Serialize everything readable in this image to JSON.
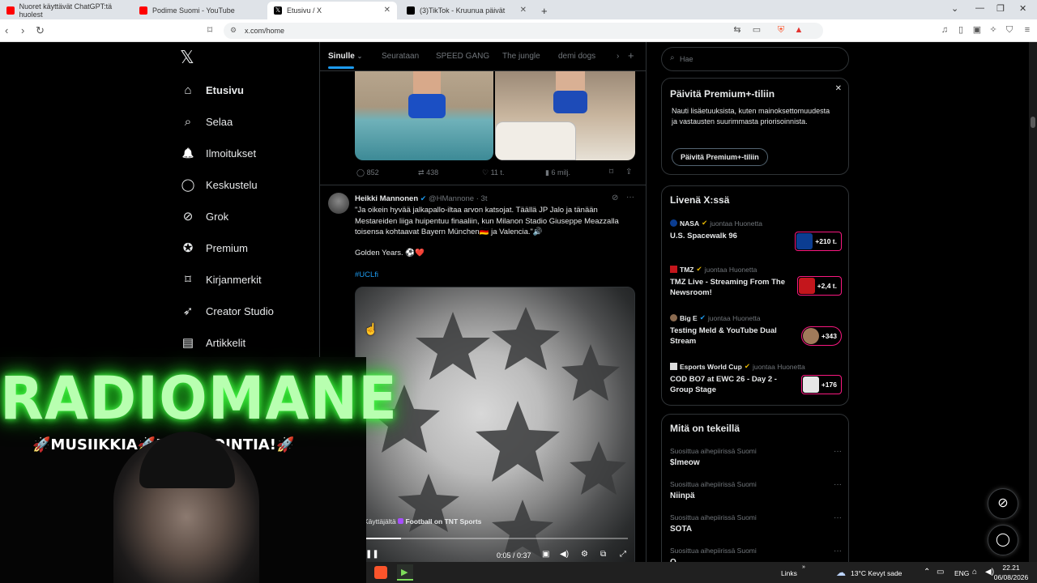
{
  "browser": {
    "tabs": [
      {
        "title": "Nuoret käyttävät ChatGPT:tä huolest",
        "color": "#ff0000"
      },
      {
        "title": "Podime Suomi - YouTube",
        "color": "#ff0000"
      },
      {
        "title": "Etusivu / X",
        "color": "#000000"
      },
      {
        "title": "(3)TikTok - Kruunua päivät",
        "color": "#000000"
      }
    ],
    "new_tab": "+",
    "url": "x.com/home"
  },
  "nav": {
    "logo": "𝕏",
    "items": [
      {
        "label": "Etusivu",
        "icon": "home-icon",
        "glyph": "⌂"
      },
      {
        "label": "Selaa",
        "icon": "search-icon",
        "glyph": "⌕"
      },
      {
        "label": "Ilmoitukset",
        "icon": "bell-icon",
        "glyph": "🔔"
      },
      {
        "label": "Keskustelu",
        "icon": "chat-icon",
        "glyph": "◯"
      },
      {
        "label": "Grok",
        "icon": "grok-icon",
        "glyph": "⊘"
      },
      {
        "label": "Premium",
        "icon": "premium-icon",
        "glyph": "✪"
      },
      {
        "label": "Kirjanmerkit",
        "icon": "bookmark-icon",
        "glyph": "⌑"
      },
      {
        "label": "Creator Studio",
        "icon": "rocket-icon",
        "glyph": "➶"
      },
      {
        "label": "Artikkelit",
        "icon": "article-icon",
        "glyph": "▤"
      }
    ]
  },
  "feed": {
    "tabs": [
      "Sinulle",
      "Seurataan",
      "SPEED GANG",
      "The jungle",
      "demi dogs"
    ],
    "add_tab": "+",
    "prev_tweet_stats": {
      "replies": "852",
      "reposts": "438",
      "likes": "11 t.",
      "views": "6 milj."
    },
    "tweet": {
      "name": "Heikki Mannonen",
      "handle": "@HMannone",
      "time": "3t",
      "text": "\"Ja oikein hyvää jalkapallo-iltaa arvon katsojat. Täällä JP Jalo ja tänään Mestareiden liiga huipentuu finaaliin, kun Milanon Stadio Giuseppe Meazzalla toisensa kohtaavat Bayern München🇩🇪 ja Valencia.\"🔊",
      "line2": "Golden Years. ⚽❤️",
      "hashtag": "#UCLfi",
      "video": {
        "attribution_prefix": "Käyttäjältä",
        "attribution_name": "Football on TNT Sports",
        "time": "0:05 / 0:37",
        "progress": 0.14
      }
    }
  },
  "sidebar": {
    "search_placeholder": "Hae",
    "premium": {
      "title": "Päivitä Premium+-tiliin",
      "body": "Nauti lisäetuuksista, kuten mainoksettomuudesta ja vastausten suurimmasta priorisoinnista.",
      "button": "Päivitä Premium+-tiliin"
    },
    "live": {
      "title": "Livenä X:ssä",
      "items": [
        {
          "account": "NASA",
          "suffix": "juontaa Huonetta",
          "title": "U.S. Spacewalk 96",
          "count": "+210 t."
        },
        {
          "account": "TMZ",
          "suffix": "juontaa Huonetta",
          "title": "TMZ Live - Streaming From The Newsroom!",
          "count": "+2,4 t."
        },
        {
          "account": "Big E",
          "suffix": "juontaa Huonetta",
          "title": "Testing Meld & YouTube Dual Stream",
          "count": "+343"
        },
        {
          "account": "Esports World Cup",
          "suffix": "juontaa Huonetta",
          "title": "COD BO7 at EWC 26 - Day 2 - Group Stage",
          "count": "+176"
        }
      ]
    },
    "trends": {
      "title": "Mitä on tekeillä",
      "items": [
        {
          "meta": "Suosittua aihepiirissä Suomi",
          "name": "$lmeow"
        },
        {
          "meta": "Suosittua aihepiirissä Suomi",
          "name": "Niinpä"
        },
        {
          "meta": "Suosittua aihepiirissä Suomi",
          "name": "SOTA"
        },
        {
          "meta": "Suosittua aihepiirissä Suomi",
          "name": "Q..."
        }
      ]
    }
  },
  "overlay": {
    "title": "RADIOMANE",
    "subtitle": "🚀MUSIIKKIA🚀JU...AGOINTIA!🚀"
  },
  "taskbar": {
    "links": "Links",
    "weather": "13°C  Kevyt sade",
    "lang": "ENG",
    "time": "22.21",
    "date": "06/08/2026"
  }
}
